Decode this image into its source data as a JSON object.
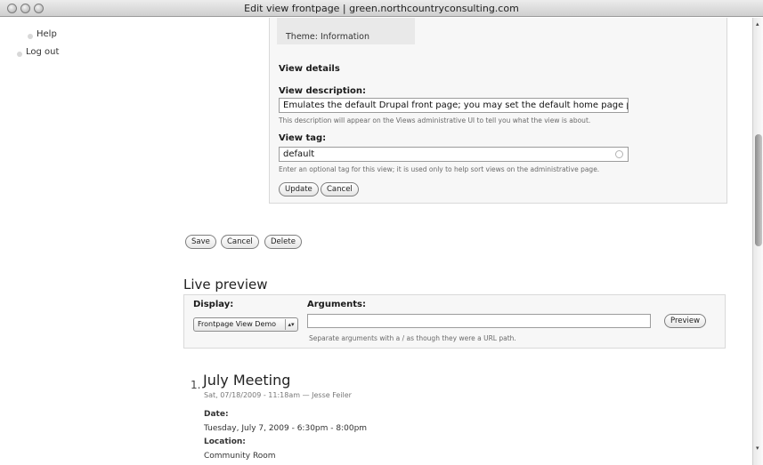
{
  "window": {
    "title": "Edit view frontpage | green.northcountryconsulting.com"
  },
  "sidebar": {
    "items": [
      {
        "label": "Help"
      },
      {
        "label": "Log out"
      }
    ]
  },
  "theme": {
    "text": "Theme: Information"
  },
  "view_details": {
    "heading": "View details",
    "description_label": "View description:",
    "description_value": "Emulates the default Drupal front page; you may set the default home page path",
    "description_help": "This description will appear on the Views administrative UI to tell you what the view is about.",
    "tag_label": "View tag:",
    "tag_value": "default",
    "tag_help": "Enter an optional tag for this view; it is used only to help sort views on the administrative page.",
    "update_label": "Update",
    "cancel_label": "Cancel"
  },
  "actions": {
    "save_label": "Save",
    "cancel_label": "Cancel",
    "delete_label": "Delete"
  },
  "live_preview": {
    "title": "Live preview",
    "display_label": "Display:",
    "display_value": "Frontpage View Demo",
    "arguments_label": "Arguments:",
    "arguments_value": "",
    "arguments_help": "Separate arguments with a / as though they were a URL path.",
    "preview_label": "Preview"
  },
  "result": {
    "number": "1.",
    "title": "July Meeting",
    "meta": "Sat, 07/18/2009 - 11:18am — Jesse Feiler",
    "date_label": "Date:",
    "date_value": "Tuesday, July 7, 2009 - 6:30pm - 8:00pm",
    "location_label": "Location:",
    "location_value": "Community Room"
  }
}
